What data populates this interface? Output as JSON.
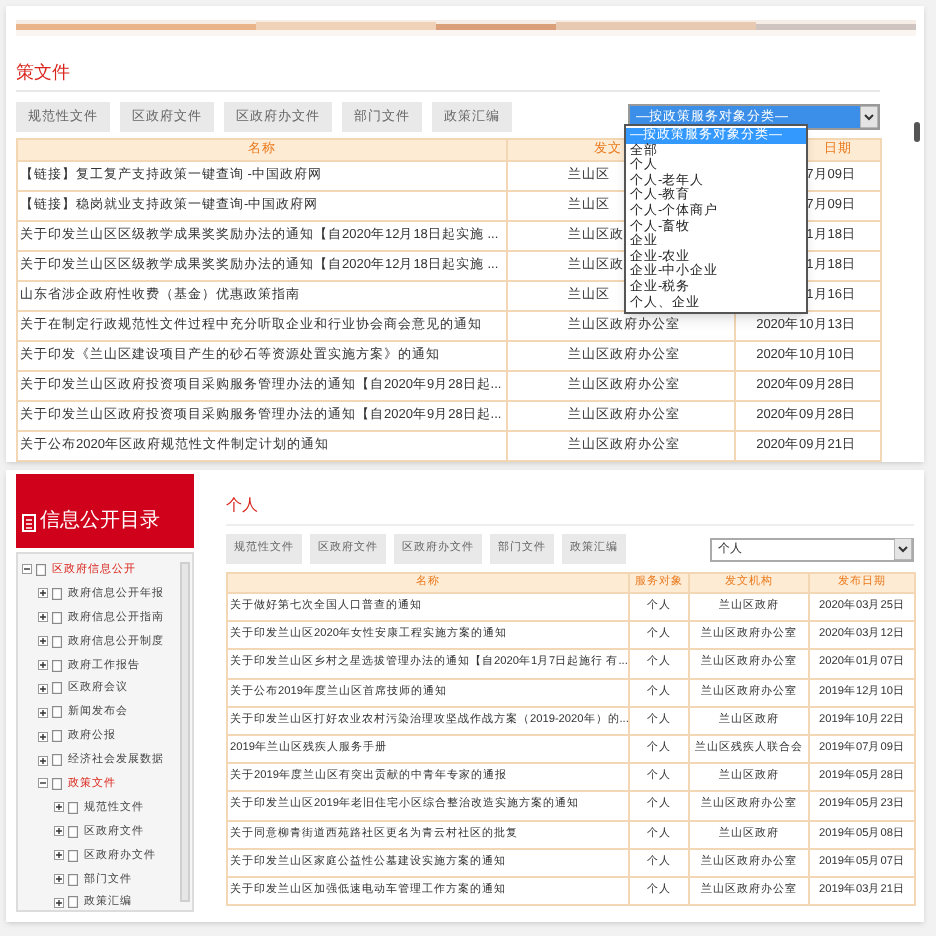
{
  "policy_section": {
    "title": "策文件",
    "tabs": [
      {
        "label": "规范性文件",
        "selected": false
      },
      {
        "label": "区政府文件",
        "selected": false
      },
      {
        "label": "区政府办文件",
        "selected": false
      },
      {
        "label": "部门文件",
        "selected": false
      },
      {
        "label": "政策汇编",
        "selected": false
      }
    ],
    "filter": {
      "value": "—按政策服务对象分类—",
      "open": true,
      "options": [
        {
          "label": "—按政策服务对象分类—",
          "selected": true
        },
        {
          "label": "全部",
          "selected": false
        },
        {
          "label": "个人",
          "selected": false
        },
        {
          "label": "个人-老年人",
          "selected": false
        },
        {
          "label": "个人-教育",
          "selected": false
        },
        {
          "label": "个人-个体商户",
          "selected": false
        },
        {
          "label": "个人-畜牧",
          "selected": false
        },
        {
          "label": "企业",
          "selected": false
        },
        {
          "label": "企业-农业",
          "selected": false
        },
        {
          "label": "企业-中小企业",
          "selected": false
        },
        {
          "label": "企业-税务",
          "selected": false
        },
        {
          "label": "个人、企业",
          "selected": false
        }
      ]
    },
    "table": {
      "columns": [
        "名称",
        "发文",
        "日期"
      ],
      "rows": [
        {
          "name": "【链接】复工复产支持政策一键查询 -中国政府网",
          "issuer": "兰山区",
          "date": "7月09日"
        },
        {
          "name": "【链接】稳岗就业支持政策一键查询-中国政府网",
          "issuer": "兰山区",
          "date": "7月09日"
        },
        {
          "name": "关于印发兰山区区级教学成果奖奖励办法的通知【自2020年12月18日起实施 ...",
          "issuer": "兰山区政",
          "date": "1月18日"
        },
        {
          "name": "关于印发兰山区区级教学成果奖奖励办法的通知【自2020年12月18日起实施 ...",
          "issuer": "兰山区政",
          "date": "1月18日"
        },
        {
          "name": "山东省涉企政府性收费（基金）优惠政策指南",
          "issuer": "兰山区",
          "date": "1月16日"
        },
        {
          "name": "关于在制定行政规范性文件过程中充分听取企业和行业协会商会意见的通知",
          "issuer": "兰山区政府办公室",
          "date": "2020年10月13日"
        },
        {
          "name": "关于印发《兰山区建设项目产生的砂石等资源处置实施方案》的通知",
          "issuer": "兰山区政府办公室",
          "date": "2020年10月10日"
        },
        {
          "name": "关于印发兰山区政府投资项目采购服务管理办法的通知【自2020年9月28日起...",
          "issuer": "兰山区政府办公室",
          "date": "2020年09月28日"
        },
        {
          "name": "关于印发兰山区政府投资项目采购服务管理办法的通知【自2020年9月28日起...",
          "issuer": "兰山区政府办公室",
          "date": "2020年09月28日"
        },
        {
          "name": "关于公布2020年区政府规范性文件制定计划的通知",
          "issuer": "兰山区政府办公室",
          "date": "2020年09月21日"
        }
      ]
    }
  },
  "directory": {
    "title": "信息公开目录",
    "tree": [
      {
        "label": "区政府信息公开",
        "selected": true,
        "expanded": true,
        "children": [
          {
            "label": "政府信息公开年报",
            "selected": false,
            "expanded": false
          },
          {
            "label": "政府信息公开指南",
            "selected": false,
            "expanded": false
          },
          {
            "label": "政府信息公开制度",
            "selected": false,
            "expanded": false
          },
          {
            "label": "政府工作报告",
            "selected": false,
            "expanded": false
          },
          {
            "label": "区政府会议",
            "selected": false,
            "expanded": false
          },
          {
            "label": "新闻发布会",
            "selected": false,
            "expanded": false
          },
          {
            "label": "政府公报",
            "selected": false,
            "expanded": false
          },
          {
            "label": "经济社会发展数据",
            "selected": false,
            "expanded": false
          },
          {
            "label": "政策文件",
            "selected": true,
            "expanded": true,
            "children": [
              {
                "label": "规范性文件",
                "selected": false,
                "expanded": false
              },
              {
                "label": "区政府文件",
                "selected": false,
                "expanded": false
              },
              {
                "label": "区政府办文件",
                "selected": false,
                "expanded": false
              },
              {
                "label": "部门文件",
                "selected": false,
                "expanded": false
              },
              {
                "label": "政策汇编",
                "selected": false,
                "expanded": false
              }
            ]
          }
        ]
      }
    ]
  },
  "personal_section": {
    "title": "个人",
    "tabs": [
      {
        "label": "规范性文件",
        "selected": false
      },
      {
        "label": "区政府文件",
        "selected": false
      },
      {
        "label": "区政府办文件",
        "selected": false
      },
      {
        "label": "部门文件",
        "selected": false
      },
      {
        "label": "政策汇编",
        "selected": false
      }
    ],
    "filter": {
      "value": "个人",
      "open": false
    },
    "table": {
      "columns": [
        "名称",
        "服务对象",
        "发文机构",
        "发布日期"
      ],
      "rows": [
        {
          "name": "关于做好第七次全国人口普查的通知",
          "audience": "个人",
          "issuer": "兰山区政府",
          "date": "2020年03月25日"
        },
        {
          "name": "关于印发兰山区2020年女性安康工程实施方案的通知",
          "audience": "个人",
          "issuer": "兰山区政府办公室",
          "date": "2020年03月12日"
        },
        {
          "name": "关于印发兰山区乡村之星选拔管理办法的通知【自2020年1月7日起施行 有...",
          "audience": "个人",
          "issuer": "兰山区政府办公室",
          "date": "2020年01月07日"
        },
        {
          "name": "关于公布2019年度兰山区首席技师的通知",
          "audience": "个人",
          "issuer": "兰山区政府办公室",
          "date": "2019年12月10日"
        },
        {
          "name": "关于印发兰山区打好农业农村污染治理攻坚战作战方案（2019-2020年）的...",
          "audience": "个人",
          "issuer": "兰山区政府",
          "date": "2019年10月22日"
        },
        {
          "name": "2019年兰山区残疾人服务手册",
          "audience": "个人",
          "issuer": "兰山区残疾人联合会",
          "date": "2019年07月09日"
        },
        {
          "name": "关于2019年度兰山区有突出贡献的中青年专家的通报",
          "audience": "个人",
          "issuer": "兰山区政府",
          "date": "2019年05月28日"
        },
        {
          "name": "关于印发兰山区2019年老旧住宅小区综合整治改造实施方案的通知",
          "audience": "个人",
          "issuer": "兰山区政府办公室",
          "date": "2019年05月23日"
        },
        {
          "name": "关于同意柳青街道西苑路社区更名为青云村社区的批复",
          "audience": "个人",
          "issuer": "兰山区政府",
          "date": "2019年05月08日"
        },
        {
          "name": "关于印发兰山区家庭公益性公墓建设实施方案的通知",
          "audience": "个人",
          "issuer": "兰山区政府办公室",
          "date": "2019年05月07日"
        },
        {
          "name": "关于印发兰山区加强低速电动车管理工作方案的通知",
          "audience": "个人",
          "issuer": "兰山区政府办公室",
          "date": "2019年03月21日"
        }
      ]
    }
  }
}
